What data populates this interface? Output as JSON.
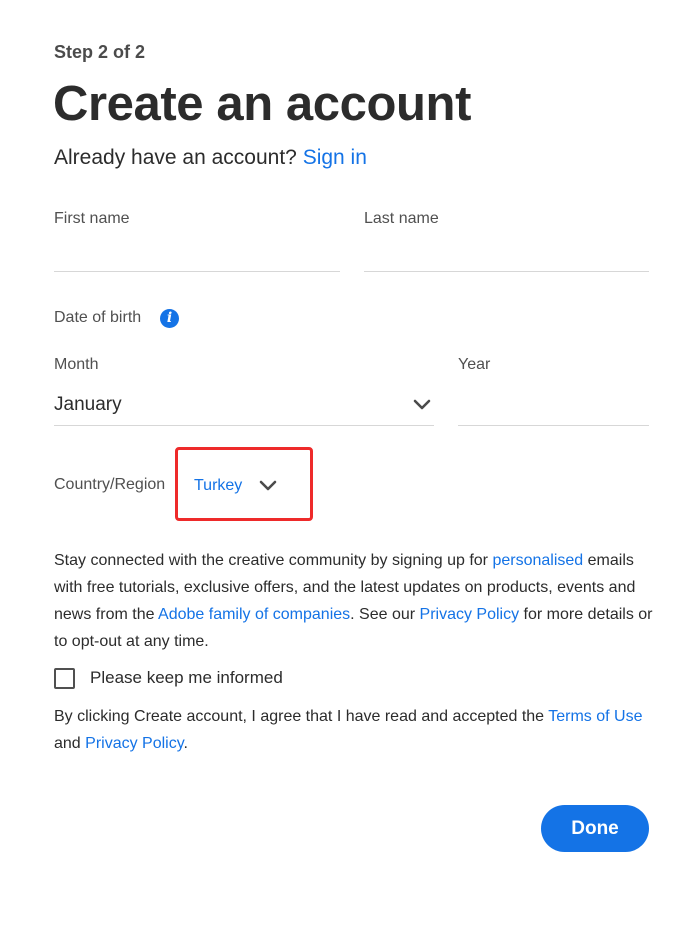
{
  "header": {
    "step": "Step 2 of 2",
    "title": "Create an account",
    "have_account": "Already have an account?",
    "sign_in": "Sign in"
  },
  "form": {
    "first_name_label": "First name",
    "first_name_value": "",
    "last_name_label": "Last name",
    "last_name_value": "",
    "dob_label": "Date of birth",
    "info_glyph": "i",
    "month_label": "Month",
    "month_value": "January",
    "year_label": "Year",
    "year_value": "",
    "country_label": "Country/Region",
    "country_value": "Turkey"
  },
  "marketing": {
    "t1": "Stay connected with the creative community by signing up for ",
    "link_personalised": "personalised",
    "t2": " emails with free tutorials, exclusive offers, and the latest updates on products, events and news from the ",
    "link_adobe_family": "Adobe family of companies",
    "t3": ". See our ",
    "link_privacy": "Privacy Policy",
    "t4": " for more details or to opt-out at any time.",
    "checkbox_label": "Please keep me informed",
    "checkbox_checked": false
  },
  "terms": {
    "t1": "By clicking Create account, I agree that I have read and accepted the ",
    "link_terms": "Terms of Use",
    "t2": " and ",
    "link_privacy": "Privacy Policy",
    "t3": "."
  },
  "actions": {
    "done_label": "Done"
  },
  "colors": {
    "accent": "#1473e6",
    "highlight": "#ee2a2a",
    "text": "#2c2c2c"
  },
  "icons": {
    "dob_info": "info-icon",
    "month_chevron": "chevron-down-icon",
    "country_chevron": "chevron-down-icon"
  }
}
